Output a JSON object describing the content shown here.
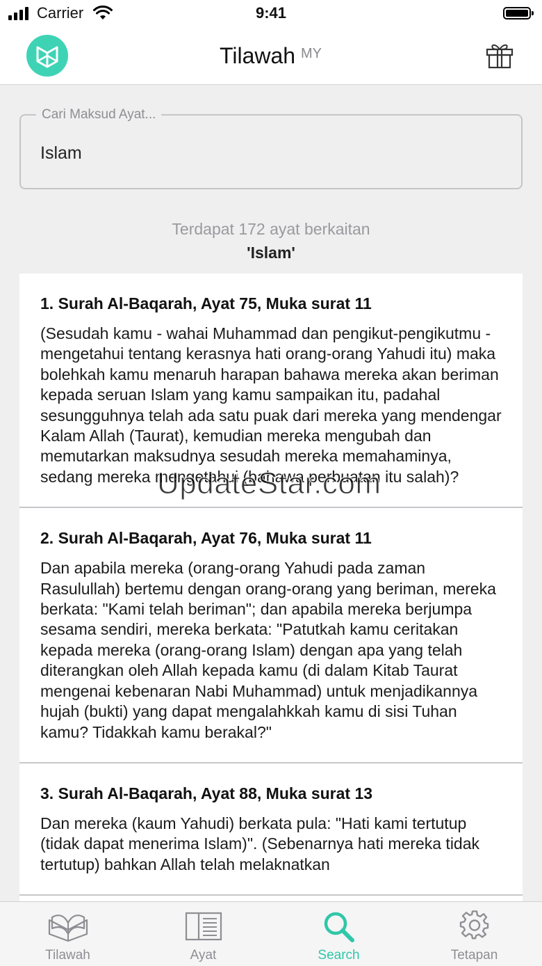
{
  "status_bar": {
    "carrier": "Carrier",
    "time": "9:41"
  },
  "nav": {
    "title": "Tilawah",
    "superscript": "MY"
  },
  "search": {
    "label": "Cari Maksud Ayat...",
    "value": "Islam"
  },
  "summary": {
    "count_text": "Terdapat 172 ayat berkaitan",
    "query_text": "'Islam'"
  },
  "results": [
    {
      "title": "1. Surah Al-Baqarah, Ayat 75, Muka surat 11",
      "text": "(Sesudah kamu - wahai Muhammad dan pengikut-pengikutmu - mengetahui tentang kerasnya hati orang-orang Yahudi itu) maka bolehkah kamu menaruh harapan bahawa mereka akan beriman kepada seruan Islam yang kamu sampaikan itu, padahal sesungguhnya telah ada satu puak dari mereka yang mendengar Kalam Allah (Taurat), kemudian mereka mengubah dan memutarkan maksudnya sesudah mereka memahaminya, sedang mereka mengetahui (bahawa perbuatan itu salah)?"
    },
    {
      "title": "2. Surah Al-Baqarah, Ayat 76, Muka surat 11",
      "text": "Dan apabila mereka (orang-orang Yahudi pada zaman Rasulullah) bertemu dengan orang-orang yang beriman, mereka berkata: \"Kami telah beriman\"; dan apabila mereka berjumpa sesama sendiri, mereka berkata: \"Patutkah kamu ceritakan kepada mereka (orang-orang Islam) dengan apa yang telah diterangkan oleh Allah kepada kamu (di dalam Kitab Taurat mengenai kebenaran Nabi Muhammad) untuk menjadikannya hujah (bukti) yang dapat mengalahkkah kamu di sisi Tuhan kamu? Tidakkah kamu berakal?\""
    },
    {
      "title": "3. Surah Al-Baqarah, Ayat 88, Muka surat 13",
      "text": "Dan mereka (kaum Yahudi) berkata pula: \"Hati kami tertutup (tidak dapat menerima Islam)\". (Sebenarnya hati mereka tidak tertutup) bahkan Allah telah melaknatkan"
    }
  ],
  "watermark": "UpdateStar.com",
  "tabs": [
    {
      "label": "Tilawah",
      "icon": "open-book-icon"
    },
    {
      "label": "Ayat",
      "icon": "book-page-icon"
    },
    {
      "label": "Search",
      "icon": "search-icon",
      "active": true
    },
    {
      "label": "Tetapan",
      "icon": "gear-icon"
    }
  ],
  "colors": {
    "accent": "#2fc7a8",
    "logo": "#3fd3b6",
    "background": "#efeff0"
  }
}
